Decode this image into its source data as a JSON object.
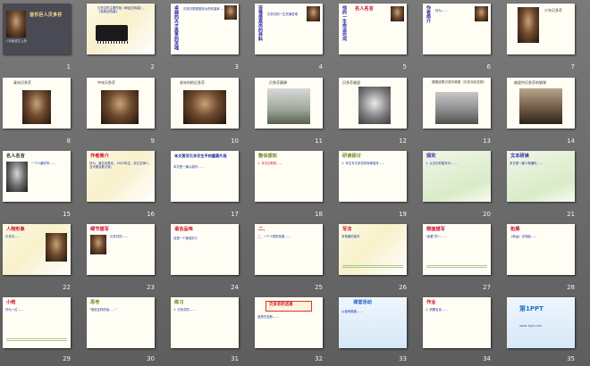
{
  "slides": [
    {
      "num": "1",
      "title": "音乐巨人贝多芬",
      "subtitle": "八年级语文上册"
    },
    {
      "num": "2",
      "text": "贝多芬的主要作品《命运交响曲》、《英雄交响曲》"
    },
    {
      "num": "3",
      "title": "卓越的天才高贵的灵魂",
      "text": "贝多芬是德国伟大的作曲家……"
    },
    {
      "num": "4",
      "title": "苦难是高尚的养料",
      "text": "贝多芬的一生充满苦难"
    },
    {
      "num": "5",
      "title": "他的一生命运坎坷",
      "vert": "名人名言"
    },
    {
      "num": "6",
      "title": "作者简介",
      "text": "何为……"
    },
    {
      "num": "7",
      "caption": "少年贝多芬"
    },
    {
      "num": "8",
      "caption": "青年贝多芬"
    },
    {
      "num": "9",
      "caption": "中年贝多芬"
    },
    {
      "num": "10",
      "caption": "老年时的贝多芬"
    },
    {
      "num": "11",
      "caption": "贝多芬墓碑"
    },
    {
      "num": "12",
      "caption": "贝多芬故居"
    },
    {
      "num": "13",
      "caption": "德国波恩贝多芬故居（贝多芬纪念馆）"
    },
    {
      "num": "14",
      "caption": "故居中贝多芬的钢琴"
    },
    {
      "num": "15",
      "title": "名人名言",
      "quote": "一个人最好的……"
    },
    {
      "num": "16",
      "title": "作者简介",
      "text": "何为，原名何振业，1922年生，浙江定海人，当代著名散文家。"
    },
    {
      "num": "17",
      "title": "本文是写贝多芬生平的重要片段",
      "text": "本文是一篇以描写……"
    },
    {
      "num": "18",
      "title": "整体感知",
      "text": "1. 本文记叙的……"
    },
    {
      "num": "19",
      "title": "研读探讨",
      "text": "1. 本文写贝多芬的肖像描写……"
    },
    {
      "num": "20",
      "title": "探究",
      "text": "1. 从文中的描写中……"
    },
    {
      "num": "21",
      "title": "文本研读",
      "text": "本文是一篇人物通讯……"
    },
    {
      "num": "22",
      "title": "人物形象",
      "text": "贝多芬……"
    },
    {
      "num": "23",
      "title": "细节描写",
      "text": "贝多芬的……"
    },
    {
      "num": "24",
      "title": "语言品味",
      "text": "这是一个痛苦的人"
    },
    {
      "num": "25",
      "title": "二、",
      "text": "二、一个人物的形象……"
    },
    {
      "num": "26",
      "title": "写法",
      "text": "多角度的描写"
    },
    {
      "num": "27",
      "title": "侧面描写",
      "text": "“喜爱”的一……"
    },
    {
      "num": "28",
      "title": "拓展",
      "text": "《命运》交响曲……"
    },
    {
      "num": "29",
      "title": "小结",
      "text": "作为一位……"
    },
    {
      "num": "30",
      "title": "思考",
      "text": "“他说这样的话……”"
    },
    {
      "num": "31",
      "title": "练习",
      "text": "1. 贝多芬的……"
    },
    {
      "num": "32",
      "title": "贝多芬的话语",
      "text": "我是巴克斯……"
    },
    {
      "num": "33",
      "title": "课堂活动",
      "text": "从各种角度……"
    },
    {
      "num": "34",
      "title": "作业",
      "text": "1. 积累名言……"
    },
    {
      "num": "35",
      "title": "第1PPT",
      "text": "www.1ppt.com"
    }
  ]
}
